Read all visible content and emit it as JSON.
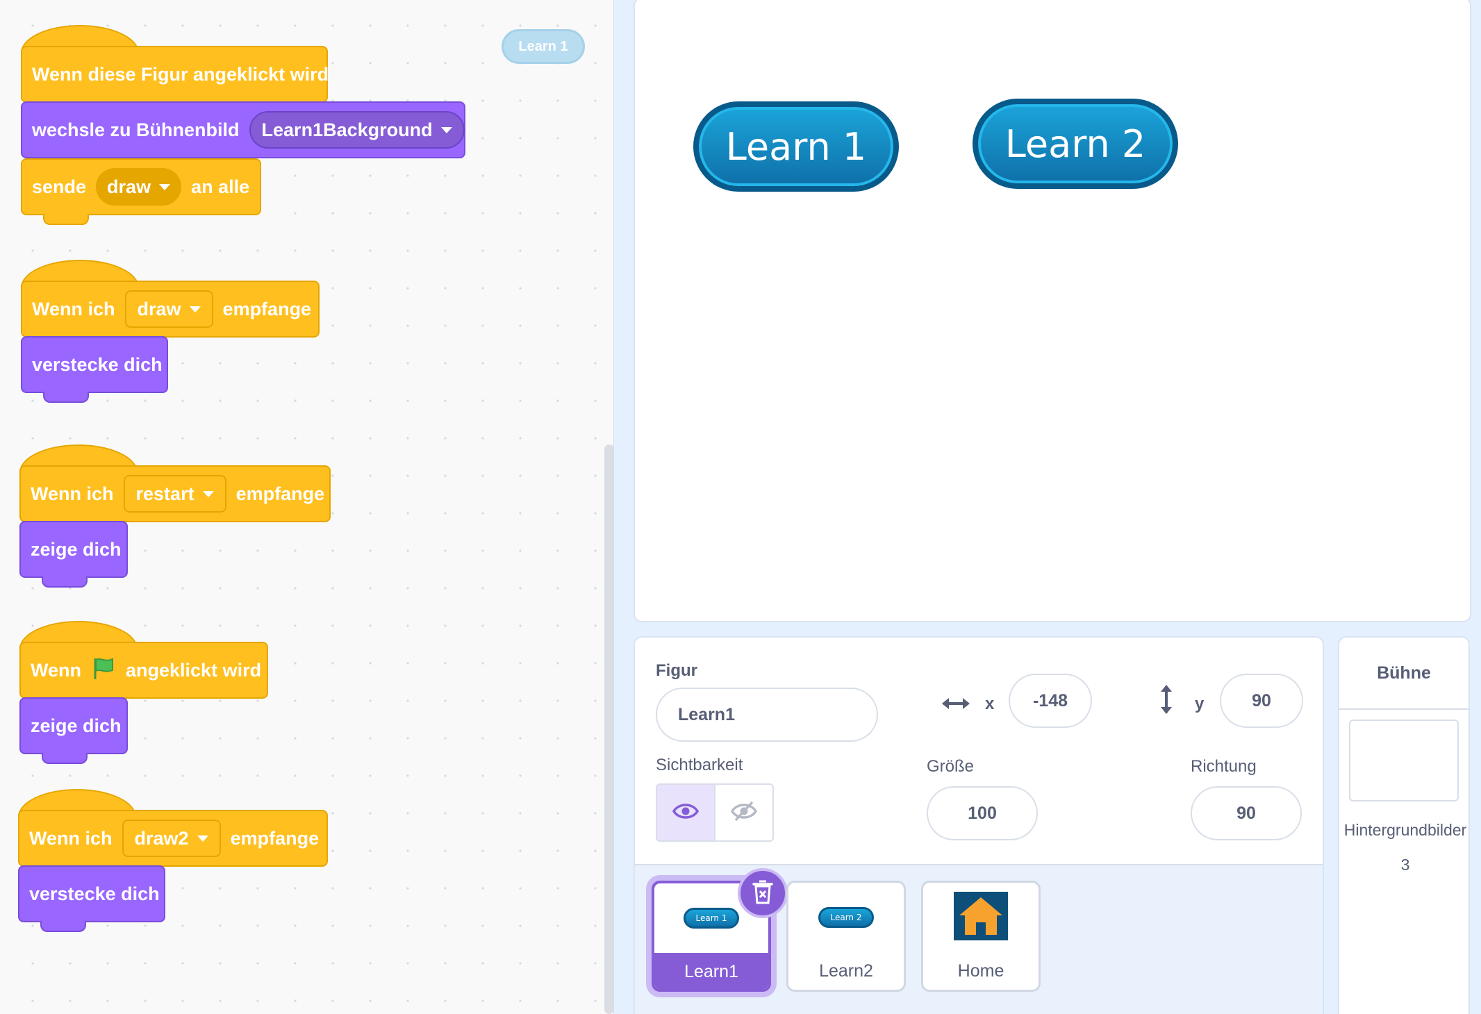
{
  "code_area": {
    "sprite_hint": "Learn 1",
    "scripts": [
      {
        "hat": {
          "text": "Wenn diese Figur angeklickt wird"
        },
        "b1": {
          "label": "wechsle zu Bühnenbild",
          "dropdown": "Learn1Background"
        },
        "b2": {
          "label_before": "sende",
          "dropdown": "draw",
          "label_after": "an alle"
        }
      },
      {
        "hat": {
          "label_before": "Wenn ich",
          "dropdown": "draw",
          "label_after": "empfange"
        },
        "b1": {
          "text": "verstecke dich"
        }
      },
      {
        "hat": {
          "label_before": "Wenn ich",
          "dropdown": "restart",
          "label_after": "empfange"
        },
        "b1": {
          "text": "zeige dich"
        }
      },
      {
        "hat": {
          "label_before": "Wenn",
          "icon": "green-flag-icon",
          "label_after": "angeklickt wird"
        },
        "b1": {
          "text": "zeige dich"
        }
      },
      {
        "hat": {
          "label_before": "Wenn ich",
          "dropdown": "draw2",
          "label_after": "empfange"
        },
        "b1": {
          "text": "verstecke dich"
        }
      }
    ]
  },
  "stage": {
    "sprites": [
      {
        "label": "Learn 1"
      },
      {
        "label": "Learn 2"
      }
    ]
  },
  "sprite_info": {
    "figure_label": "Figur",
    "figure_name": "Learn1",
    "x_label": "x",
    "x_value": "-148",
    "y_label": "y",
    "y_value": "90",
    "visibility_label": "Sichtbarkeit",
    "size_label": "Größe",
    "size_value": "100",
    "direction_label": "Richtung",
    "direction_value": "90",
    "icons": {
      "show": "eye-icon",
      "hide": "eye-slash-icon",
      "x_axis": "horizontal-arrows-icon",
      "y_axis": "vertical-arrows-icon"
    }
  },
  "sprite_list": [
    {
      "name": "Learn1",
      "thumb_text": "Learn 1",
      "selected": true
    },
    {
      "name": "Learn2",
      "thumb_text": "Learn 2",
      "selected": false
    },
    {
      "name": "Home",
      "thumb_icon": "house-icon",
      "selected": false
    }
  ],
  "stage_selector": {
    "title": "Bühne",
    "backdrops_label": "Hintergrundbilder",
    "backdrops_count": "3"
  },
  "colors": {
    "events": "#ffbf1f",
    "looks": "#9966ff",
    "accent": "#855cd6",
    "sprite_button": "#1b8fcc"
  }
}
